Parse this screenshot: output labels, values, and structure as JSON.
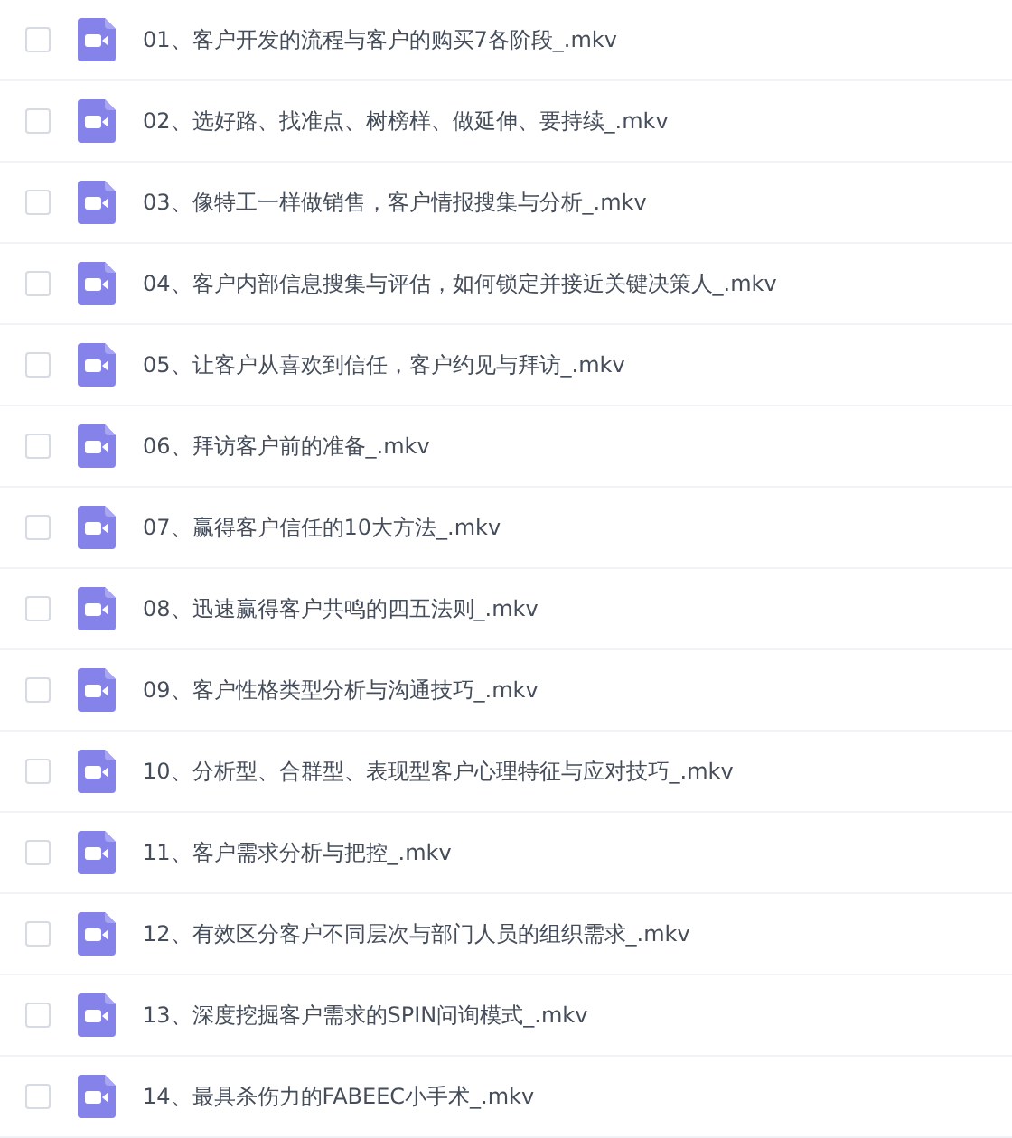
{
  "files": [
    {
      "name": "01、客户开发的流程与客户的购买7各阶段_.mkv",
      "checked": false
    },
    {
      "name": "02、选好路、找准点、树榜样、做延伸、要持续_.mkv",
      "checked": false
    },
    {
      "name": "03、像特工一样做销售，客户情报搜集与分析_.mkv",
      "checked": false
    },
    {
      "name": "04、客户内部信息搜集与评估，如何锁定并接近关键决策人_.mkv",
      "checked": false
    },
    {
      "name": "05、让客户从喜欢到信任，客户约见与拜访_.mkv",
      "checked": false
    },
    {
      "name": "06、拜访客户前的准备_.mkv",
      "checked": false
    },
    {
      "name": "07、赢得客户信任的10大方法_.mkv",
      "checked": false
    },
    {
      "name": "08、迅速赢得客户共鸣的四五法则_.mkv",
      "checked": false
    },
    {
      "name": "09、客户性格类型分析与沟通技巧_.mkv",
      "checked": false
    },
    {
      "name": "10、分析型、合群型、表现型客户心理特征与应对技巧_.mkv",
      "checked": false
    },
    {
      "name": "11、客户需求分析与把控_.mkv",
      "checked": false
    },
    {
      "name": "12、有效区分客户不同层次与部门人员的组织需求_.mkv",
      "checked": false
    },
    {
      "name": "13、深度挖掘客户需求的SPIN问询模式_.mkv",
      "checked": false
    },
    {
      "name": "14、最具杀伤力的FABEEC小手术_.mkv",
      "checked": false
    }
  ]
}
